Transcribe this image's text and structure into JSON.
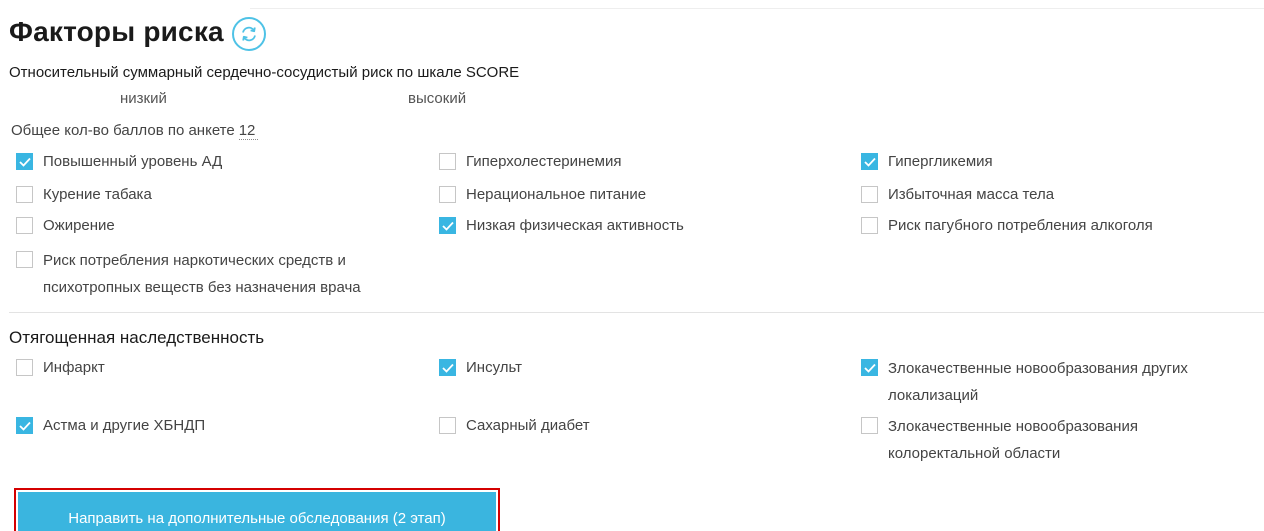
{
  "title": "Факторы риска",
  "refresh_icon": "refresh-icon",
  "score": {
    "label": "Относительный суммарный сердечно-сосудистый риск по шкале SCORE",
    "low": "низкий",
    "high": "высокий"
  },
  "total": {
    "label": "Общее кол-во баллов по анкете",
    "value": "12"
  },
  "colors": {
    "accent": "#39b6e2",
    "button": "#3ab5df",
    "highlight_border": "#d40000"
  },
  "risk_factors": [
    {
      "label": "Повышенный уровень АД",
      "checked": true
    },
    {
      "label": "Гиперхолестеринемия",
      "checked": false
    },
    {
      "label": "Гипергликемия",
      "checked": true
    },
    {
      "label": "Курение табака",
      "checked": false
    },
    {
      "label": "Нерациональное питание",
      "checked": false
    },
    {
      "label": "Избыточная масса тела",
      "checked": false
    },
    {
      "label": "Ожирение",
      "checked": false
    },
    {
      "label": "Низкая физическая активность",
      "checked": true
    },
    {
      "label": "Риск пагубного потребления алкоголя",
      "checked": false
    },
    {
      "label_line1": "Риск потребления наркотических средств и",
      "label_line2": "психотропных веществ без назначения врача",
      "checked": false
    }
  ],
  "heredity": {
    "title": "Отягощенная наследственность",
    "items": [
      {
        "label": "Инфаркт",
        "checked": false
      },
      {
        "label": "Инсульт",
        "checked": true
      },
      {
        "label_line1": "Злокачественные новообразования других",
        "label_line2": "локализаций",
        "checked": true
      },
      {
        "label": "Астма и другие ХБНДП",
        "checked": true
      },
      {
        "label": "Сахарный диабет",
        "checked": false
      },
      {
        "label_line1": "Злокачественные новообразования",
        "label_line2": "колоректальной области",
        "checked": false
      }
    ]
  },
  "action_button": "Направить на дополнительные обследования (2 этап)"
}
